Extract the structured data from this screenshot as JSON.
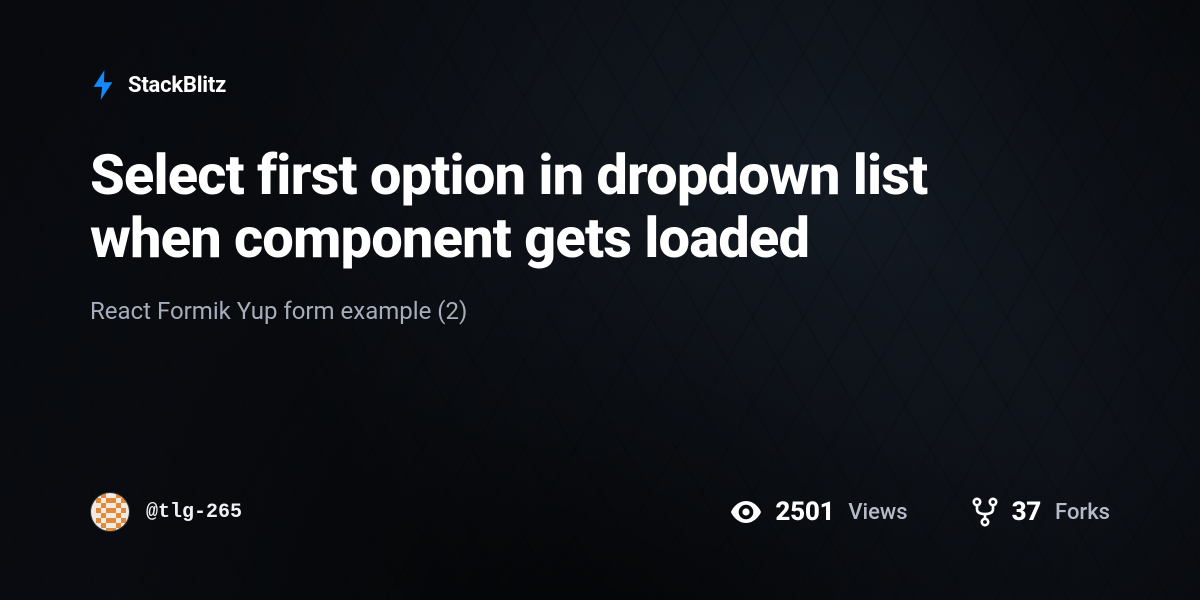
{
  "brand": {
    "name": "StackBlitz",
    "accent": "#1389FD"
  },
  "title": "Select first option in dropdown list when component gets loaded",
  "subtitle": "React Formik Yup form example (2)",
  "author": {
    "handle": "@tlg-265"
  },
  "stats": {
    "views": {
      "value": "2501",
      "label": "Views"
    },
    "forks": {
      "value": "37",
      "label": "Forks"
    }
  }
}
